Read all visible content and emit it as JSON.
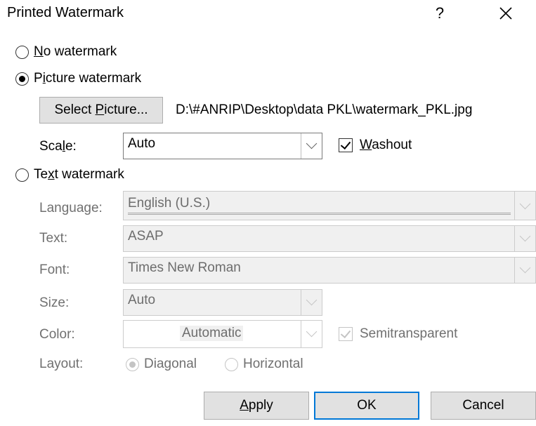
{
  "window": {
    "title": "Printed Watermark",
    "help_label": "?",
    "close_icon": "close-icon"
  },
  "options": {
    "no_watermark": {
      "label_prefix": "",
      "label_key": "N",
      "label_rest": "o watermark",
      "selected": false
    },
    "picture_watermark": {
      "label_prefix": "P",
      "label_key": "i",
      "label_rest": "cture watermark",
      "selected": true
    },
    "text_watermark": {
      "label_prefix": "Te",
      "label_key": "x",
      "label_rest": "t watermark",
      "selected": false
    }
  },
  "picture": {
    "select_button_prefix": "Select ",
    "select_button_key": "P",
    "select_button_rest": "icture...",
    "path": "D:\\#ANRIP\\Desktop\\data PKL\\watermark_PKL.jpg",
    "scale_label_prefix": "Sca",
    "scale_label_key": "l",
    "scale_label_rest": "e:",
    "scale_value": "Auto",
    "washout_key": "W",
    "washout_rest": "ashout",
    "washout_checked": true
  },
  "text": {
    "language_label": "Language:",
    "language_value": "English (U.S.)",
    "text_label": "Text:",
    "text_value": "ASAP",
    "font_label": "Font:",
    "font_value": "Times New Roman",
    "size_label": "Size:",
    "size_value": "Auto",
    "color_label": "Color:",
    "color_value": "Automatic",
    "semitransparent_label": "Semitransparent",
    "semitransparent_checked": true,
    "layout_label": "Layout:",
    "layout_diagonal": "Diagonal",
    "layout_horizontal": "Horizontal",
    "layout_selected": "Diagonal"
  },
  "buttons": {
    "apply_key": "A",
    "apply_rest": "pply",
    "ok": "OK",
    "cancel": "Cancel"
  },
  "colors": {
    "accent": "#0078d7",
    "button_face": "#e1e1e1",
    "disabled_text": "#707070"
  }
}
